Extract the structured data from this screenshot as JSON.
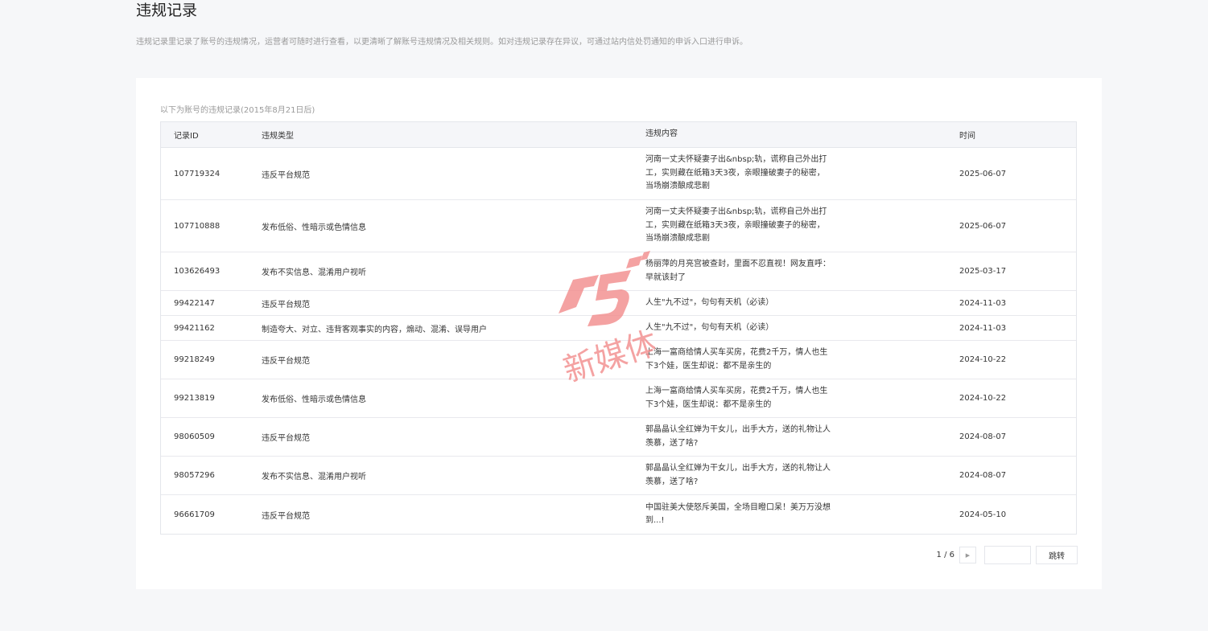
{
  "header": {
    "title": "违规记录",
    "description": "违规记录里记录了账号的违规情况，运营者可随时进行查看，以更清晰了解账号违规情况及相关规则。如对违规记录存在异议，可通过站内信处罚通知的申诉入口进行申诉。"
  },
  "panel": {
    "caption": "以下为账号的违规记录(2015年8月21日后)"
  },
  "table": {
    "columns": [
      "记录ID",
      "违规类型",
      "违规内容",
      "时间"
    ],
    "rows": [
      {
        "id": "107719324",
        "type": "违反平台规范",
        "content": "河南一丈夫怀疑妻子出&nbsp;轨，谎称自己外出打工，实则藏在纸箱3天3夜，亲眼撞破妻子的秘密，当场崩溃酿成悲剧",
        "time": "2025-06-07"
      },
      {
        "id": "107710888",
        "type": "发布低俗、性暗示或色情信息",
        "content": "河南一丈夫怀疑妻子出&nbsp;轨，谎称自己外出打工，实则藏在纸箱3天3夜，亲眼撞破妻子的秘密，当场崩溃酿成悲剧",
        "time": "2025-06-07"
      },
      {
        "id": "103626493",
        "type": "发布不实信息、混淆用户视听",
        "content": "杨丽萍的月亮宫被查封，里面不忍直视！网友直呼：早就该封了",
        "time": "2025-03-17"
      },
      {
        "id": "99422147",
        "type": "违反平台规范",
        "content": "人生\"九不过\"，句句有天机（必读）",
        "time": "2024-11-03"
      },
      {
        "id": "99421162",
        "type": "制造夸大、对立、违背客观事实的内容，煽动、混淆、误导用户",
        "content": "人生\"九不过\"，句句有天机（必读）",
        "time": "2024-11-03"
      },
      {
        "id": "99218249",
        "type": "违反平台规范",
        "content": "上海一富商给情人买车买房，花费2千万，情人也生下3个娃，医生却说：都不是亲生的",
        "time": "2024-10-22"
      },
      {
        "id": "99213819",
        "type": "发布低俗、性暗示或色情信息",
        "content": "上海一富商给情人买车买房，花费2千万，情人也生下3个娃，医生却说：都不是亲生的",
        "time": "2024-10-22"
      },
      {
        "id": "98060509",
        "type": "违反平台规范",
        "content": "郭晶晶认全红婵为干女儿，出手大方，送的礼物让人羡慕，送了啥?",
        "time": "2024-08-07"
      },
      {
        "id": "98057296",
        "type": "发布不实信息、混淆用户视听",
        "content": "郭晶晶认全红婵为干女儿，出手大方，送的礼物让人羡慕，送了啥?",
        "time": "2024-08-07"
      },
      {
        "id": "96661709",
        "type": "违反平台规范",
        "content": "中国驻美大使怒斥美国，全场目瞪口呆！美万万没想到...!",
        "time": "2024-05-10"
      }
    ]
  },
  "pager": {
    "page_text": "1 / 6",
    "next_icon": "caret-right-icon",
    "jump_input_value": "",
    "jump_label": "跳转"
  },
  "watermark": {
    "logo_text": "A5",
    "sub_text": "新媒体",
    "color": "#f28b8b"
  }
}
